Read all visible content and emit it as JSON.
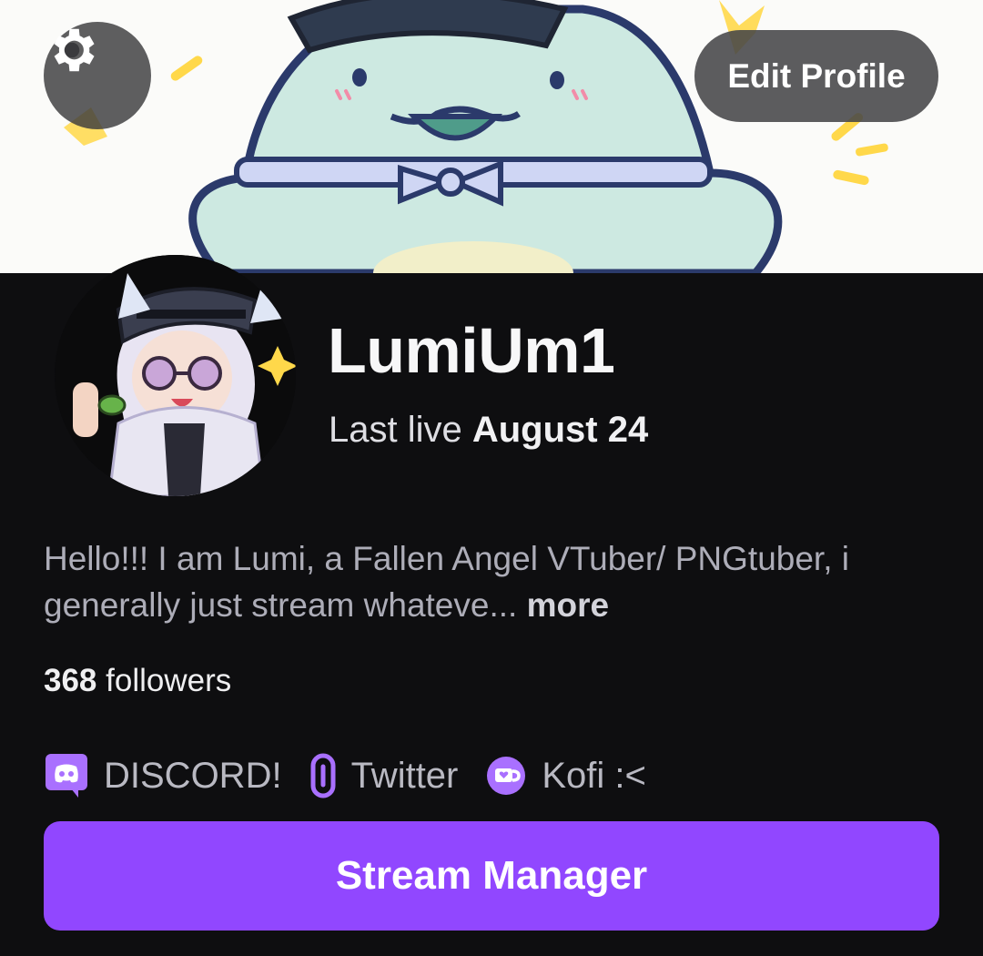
{
  "header": {
    "edit_profile_label": "Edit Profile",
    "settings_icon": "gear-icon"
  },
  "channel": {
    "name": "LumiUm1",
    "last_live_prefix": "Last live",
    "last_live_date": "August 24",
    "bio": "Hello!!! I am Lumi, a Fallen Angel VTuber/ PNGtuber, i generally just stream whateve...",
    "bio_more": "more",
    "followers_count": "368",
    "followers_label": "followers"
  },
  "social_links": [
    {
      "label": "DISCORD!",
      "icon": "discord-icon"
    },
    {
      "label": "Twitter",
      "icon": "link-icon"
    },
    {
      "label": "Kofi :<",
      "icon": "kofi-icon"
    }
  ],
  "actions": {
    "stream_manager_label": "Stream Manager"
  },
  "colors": {
    "accent": "#9147ff",
    "background": "#0e0e10",
    "link_icon": "#a970ff"
  }
}
